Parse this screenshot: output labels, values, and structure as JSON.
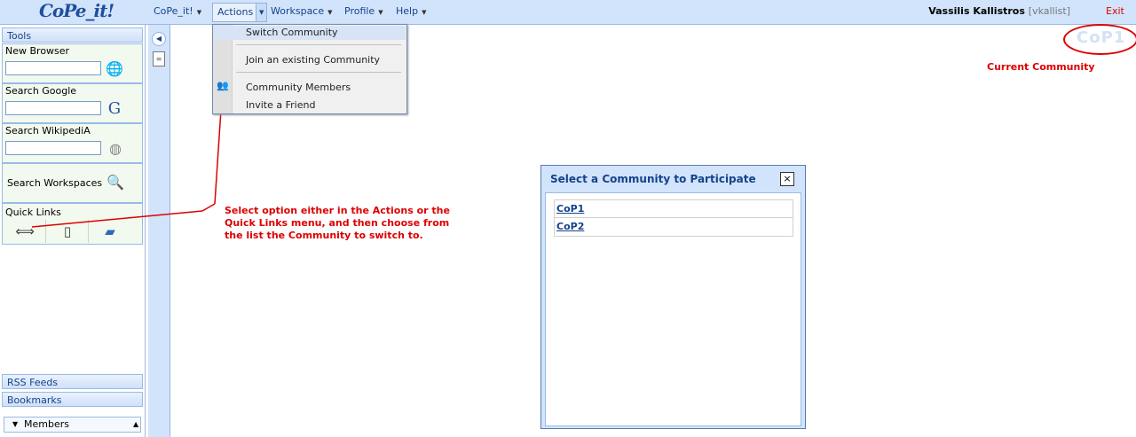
{
  "app": {
    "logo": "CoPe_it!",
    "menus": [
      {
        "label": "CoPe_it!"
      },
      {
        "label": "Actions"
      },
      {
        "label": "Workspace"
      },
      {
        "label": "Profile"
      },
      {
        "label": "Help"
      }
    ],
    "user_name": "Vassilis Kallistros",
    "user_login": "[vkallist]",
    "exit_label": "Exit"
  },
  "actions_menu": {
    "items": [
      "Switch Community",
      "Join an existing Community",
      "Community Members",
      "Invite a Friend"
    ],
    "selected": "Switch Community"
  },
  "left_panel": {
    "tools_title": "Tools",
    "new_browser": "New Browser",
    "search_google": "Search Google",
    "search_wikipedia": "Search WikipediA",
    "search_workspaces": "Search Workspaces",
    "quick_links": "Quick Links",
    "rss_feeds": "RSS Feeds",
    "bookmarks": "Bookmarks",
    "members": "Members"
  },
  "current_community": {
    "name": "CoP1",
    "label": "Current Community",
    "accent": "#dd0000"
  },
  "annotation": {
    "text": "Select  option either in the Actions or the Quick Links menu, and then choose from the list the Community to switch to."
  },
  "dialog": {
    "title": "Select a Community to Participate",
    "close": "×",
    "communities": [
      "CoP1",
      "CoP2"
    ]
  }
}
